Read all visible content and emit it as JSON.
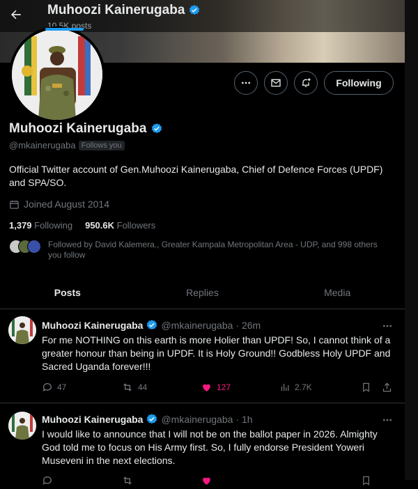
{
  "header": {
    "name": "Muhoozi Kainerugaba",
    "posts_count": "10.5K posts"
  },
  "actions": {
    "follow_label": "Following"
  },
  "profile": {
    "name": "Muhoozi Kainerugaba",
    "handle": "@mkainerugaba",
    "follows_you": "Follows you",
    "bio": "Official Twitter account of Gen.Muhoozi Kainerugaba, Chief of Defence Forces (UPDF) and SPA/SO.",
    "joined": "Joined August 2014",
    "following_count": "1,379",
    "following_label": "Following",
    "followers_count": "950.6K",
    "followers_label": "Followers",
    "followed_by": "Followed by David Kalemera., Greater Kampala Metropolitan Area - UDP, and 998 others you follow"
  },
  "tabs": [
    {
      "label": "Posts"
    },
    {
      "label": "Replies"
    },
    {
      "label": "Media"
    }
  ],
  "posts": [
    {
      "name": "Muhoozi Kainerugaba",
      "handle": "@mkainerugaba",
      "time": "· 26m",
      "text": "For me NOTHING on this earth is more Holier than UPDF! So, I cannot think of a greater honour than being in UPDF. It is Holy Ground!! Godbless Holy UPDF and Sacred Uganda forever!!!",
      "replies": "47",
      "reposts": "44",
      "likes": "127",
      "views": "2.7K"
    },
    {
      "name": "Muhoozi Kainerugaba",
      "handle": "@mkainerugaba",
      "time": "· 1h",
      "text": "I would like to announce that I  will not be on the ballot paper in 2026. Almighty God told me to focus on His Army first. So, I fully endorse President Yoweri Museveni in the next elections.",
      "replies": "",
      "reposts": "",
      "likes": "",
      "views": ""
    }
  ],
  "colors": {
    "accent": "#1d9bf0",
    "like": "#f91880",
    "muted": "#71767b",
    "border": "#2f3336"
  }
}
